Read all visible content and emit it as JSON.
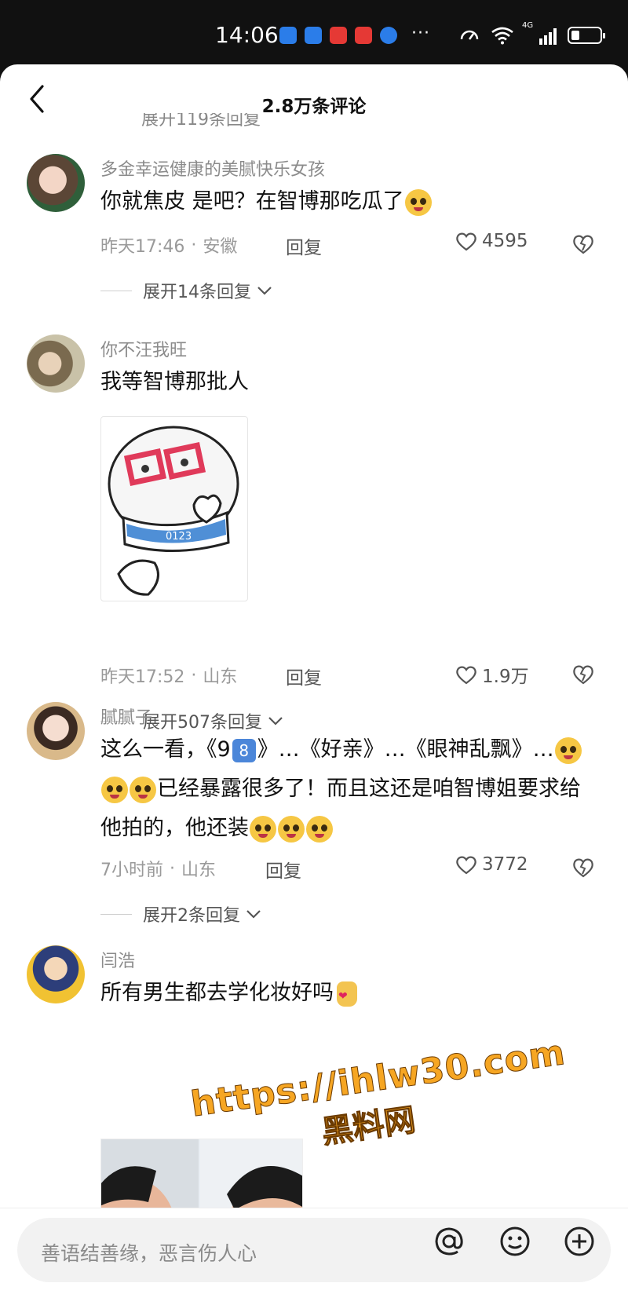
{
  "status_bar": {
    "time": "14:06",
    "dots": "···",
    "network": "4G",
    "battery_level": 0.3,
    "app_icon_colors": [
      "#1e88e5",
      "#1e88e5",
      "#e53935",
      "#e53935",
      "#1e88e5"
    ]
  },
  "header": {
    "title": "2.8万条评论",
    "ghost_text": "展开119条回复",
    "back_icon": "chevron-left-icon"
  },
  "comments": [
    {
      "username": "多金幸运健康的美腻快乐女孩",
      "text": "你就焦皮 是吧？在智博那吃瓜了",
      "time": "昨天17:46",
      "location": "安徽",
      "reply_label": "回复",
      "likes": "4595",
      "expand_label": "展开14条回复"
    },
    {
      "username": "你不汪我旺",
      "text": "我等智博那批人",
      "time": "昨天17:52",
      "location": "山东",
      "reply_label": "回复",
      "likes": "1.9万",
      "expand_label": "展开507条回复",
      "sticker_text": "0123"
    },
    {
      "username": "腻腻子",
      "text_part1": "这么一看，《9",
      "badge": "8",
      "text_part2": "》…《好亲》…《眼神乱飘》…",
      "text_part3": "已经暴露很多了！而且这还是咱智博姐要求给他拍的，他还装",
      "time": "7小时前",
      "location": "山东",
      "reply_label": "回复",
      "likes": "3772",
      "expand_label": "展开2条回复"
    },
    {
      "username": "闫浩",
      "text": "所有男生都去学化妆好吗"
    }
  ],
  "watermark": {
    "url": "https://ihlw30.com",
    "name": "黑料网"
  },
  "input": {
    "placeholder": "善语结善缘，恶言伤人心",
    "at_icon": "at-icon",
    "emoji_icon": "smiley-icon",
    "add_icon": "plus-circle-icon"
  },
  "colors": {
    "accent_gray": "#8b8b8b",
    "text_dark": "#111111",
    "watermark_orange": "#f6a623"
  }
}
